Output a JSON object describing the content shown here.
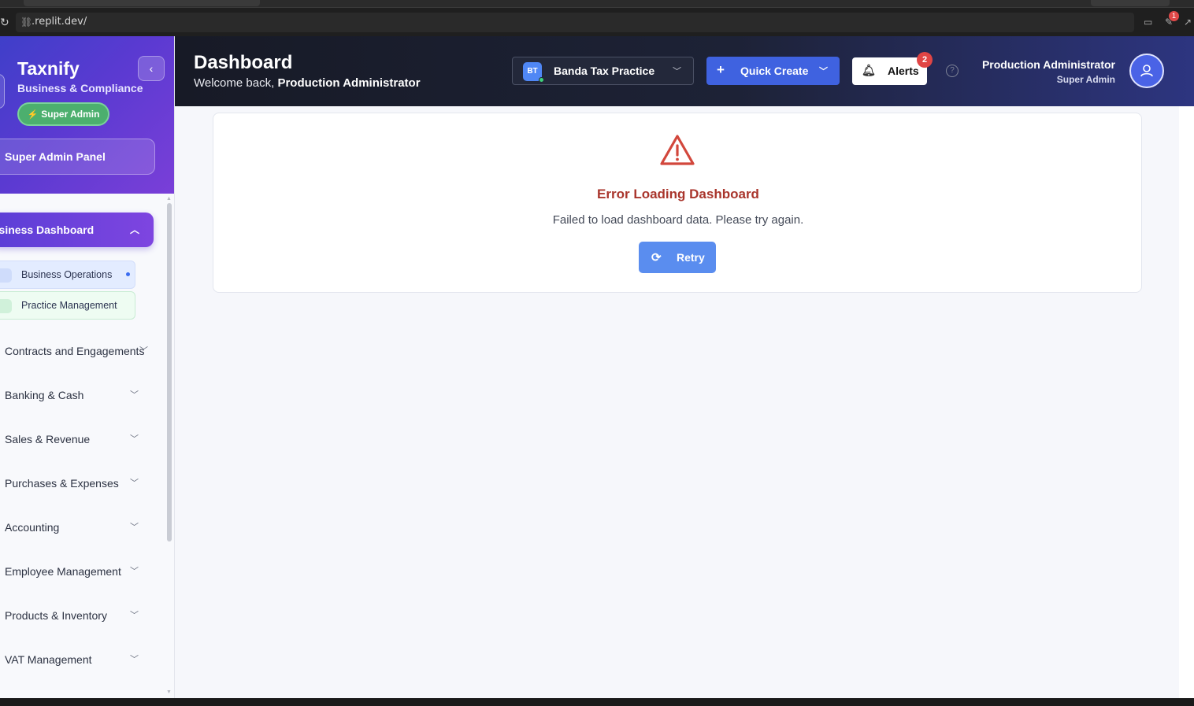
{
  "browser": {
    "url": ".replit.dev/",
    "extension_badge": "1"
  },
  "sidebar": {
    "brand": "Taxnify",
    "brand_sub": "Business & Compliance",
    "role_pill": "Super Admin",
    "panel_button": "Super Admin Panel",
    "active_group": "usiness Dashboard",
    "sub_items": [
      {
        "label": "Business Operations"
      },
      {
        "label": "Practice Management"
      }
    ],
    "items": [
      {
        "label": "Contracts and Engagements"
      },
      {
        "label": "Banking & Cash"
      },
      {
        "label": "Sales & Revenue"
      },
      {
        "label": "Purchases & Expenses"
      },
      {
        "label": "Accounting"
      },
      {
        "label": "Employee Management"
      },
      {
        "label": "Products & Inventory"
      },
      {
        "label": "VAT Management"
      }
    ]
  },
  "header": {
    "title": "Dashboard",
    "welcome_prefix": "Welcome back, ",
    "welcome_name": "Production Administrator",
    "practice": {
      "initials": "BT",
      "name": "Banda Tax Practice"
    },
    "quick_create": "Quick Create",
    "alerts": "Alerts",
    "alerts_count": "2",
    "help": "?",
    "user_name": "Production Administrator",
    "user_role": "Super Admin"
  },
  "error": {
    "title": "Error Loading Dashboard",
    "message": "Failed to load dashboard data. Please try again.",
    "retry": "Retry"
  },
  "colors": {
    "accent_blue": "#3f62e0",
    "sidebar_gradient_start": "#3f3fc9",
    "sidebar_gradient_end": "#7a3fd8",
    "error_red": "#a9352c",
    "role_green": "#4caf6e",
    "retry_blue": "#5a8def"
  }
}
